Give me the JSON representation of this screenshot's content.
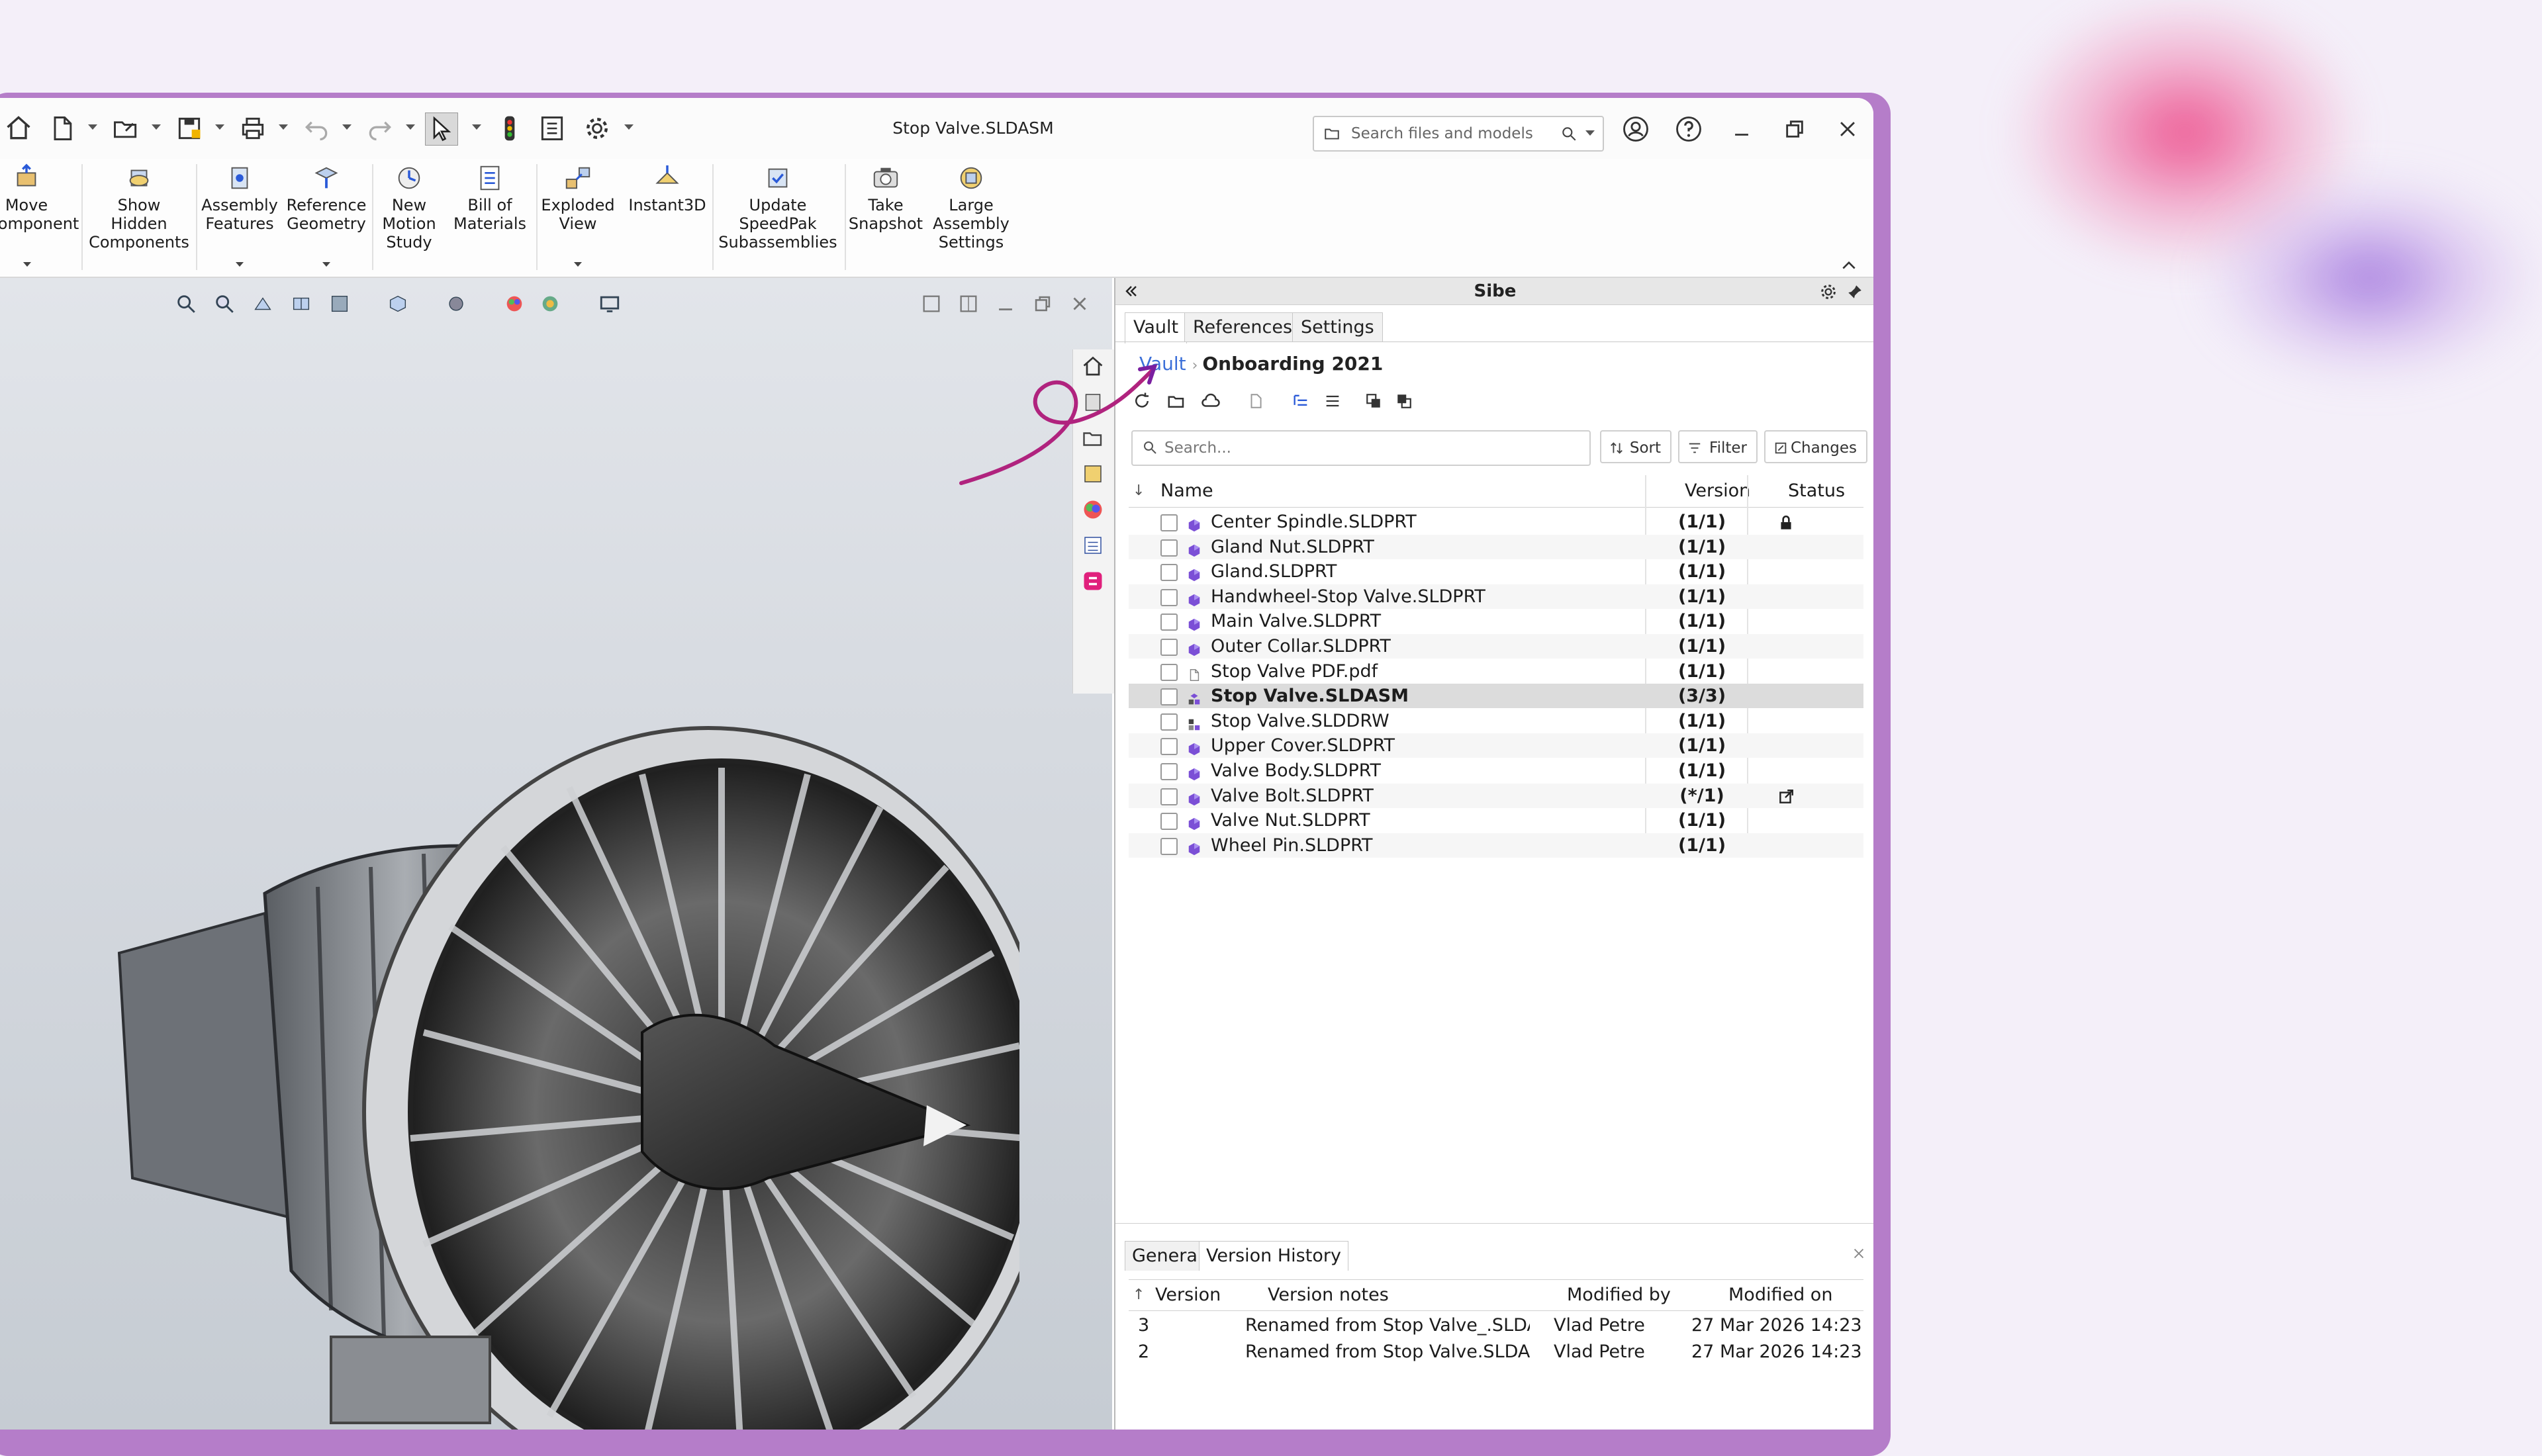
{
  "window": {
    "title": "Stop Valve.SLDASM"
  },
  "search": {
    "placeholder": "Search files and models"
  },
  "ribbon": [
    {
      "label": "Move\nComponent",
      "icon": "move-component-icon"
    },
    {
      "label": "Show\nHidden\nComponents",
      "icon": "show-hidden-icon"
    },
    {
      "label": "Assembly\nFeatures",
      "icon": "assembly-features-icon"
    },
    {
      "label": "Reference\nGeometry",
      "icon": "reference-geometry-icon"
    },
    {
      "label": "New\nMotion\nStudy",
      "icon": "motion-study-icon"
    },
    {
      "label": "Bill of\nMaterials",
      "icon": "bom-icon"
    },
    {
      "label": "Exploded\nView",
      "icon": "exploded-view-icon"
    },
    {
      "label": "Instant3D",
      "icon": "instant3d-icon"
    },
    {
      "label": "Update\nSpeedPak\nSubassemblies",
      "icon": "speedpak-icon"
    },
    {
      "label": "Take\nSnapshot",
      "icon": "camera-icon"
    },
    {
      "label": "Large\nAssembly\nSettings",
      "icon": "large-assembly-icon"
    }
  ],
  "panel": {
    "title": "Sibe",
    "tabs": [
      "Vault",
      "References",
      "Settings"
    ],
    "active_tab": "Vault",
    "breadcrumb": {
      "root": "Vault",
      "current": "Onboarding 2021"
    },
    "search_placeholder": "Search...",
    "buttons": {
      "sort": "Sort",
      "filter": "Filter",
      "changes": "Changes"
    },
    "columns": {
      "name": "Name",
      "version": "Version",
      "status": "Status"
    },
    "files": [
      {
        "name": "Center Spindle.SLDPRT",
        "version": "(1/1)",
        "type": "part",
        "status": "locked"
      },
      {
        "name": "Gland Nut.SLDPRT",
        "version": "(1/1)",
        "type": "part",
        "status": ""
      },
      {
        "name": "Gland.SLDPRT",
        "version": "(1/1)",
        "type": "part",
        "status": ""
      },
      {
        "name": "Handwheel-Stop Valve.SLDPRT",
        "version": "(1/1)",
        "type": "part",
        "status": ""
      },
      {
        "name": "Main Valve.SLDPRT",
        "version": "(1/1)",
        "type": "part",
        "status": ""
      },
      {
        "name": "Outer Collar.SLDPRT",
        "version": "(1/1)",
        "type": "part",
        "status": ""
      },
      {
        "name": "Stop Valve PDF.pdf",
        "version": "(1/1)",
        "type": "pdf",
        "status": ""
      },
      {
        "name": "Stop Valve.SLDASM",
        "version": "(3/3)",
        "type": "assembly",
        "status": "",
        "selected": true
      },
      {
        "name": "Stop Valve.SLDDRW",
        "version": "(1/1)",
        "type": "drawing",
        "status": ""
      },
      {
        "name": "Upper Cover.SLDPRT",
        "version": "(1/1)",
        "type": "part",
        "status": ""
      },
      {
        "name": "Valve Body.SLDPRT",
        "version": "(1/1)",
        "type": "part",
        "status": ""
      },
      {
        "name": "Valve Bolt.SLDPRT",
        "version": "(*/1)",
        "type": "part",
        "status": "checked-out"
      },
      {
        "name": "Valve Nut.SLDPRT",
        "version": "(1/1)",
        "type": "part",
        "status": ""
      },
      {
        "name": "Wheel Pin.SLDPRT",
        "version": "(1/1)",
        "type": "part",
        "status": ""
      }
    ],
    "bottom": {
      "tabs": [
        "General",
        "Version History"
      ],
      "active_tab": "Version History",
      "columns": {
        "version": "Version",
        "notes": "Version notes",
        "by": "Modified by",
        "on": "Modified on"
      },
      "history": [
        {
          "version": "3",
          "notes": "Renamed from Stop Valve_.SLDASM",
          "by": "Vlad Petre",
          "on": "27 Mar 2026 14:23"
        },
        {
          "version": "2",
          "notes": "Renamed from Stop Valve.SLDASM",
          "by": "Vlad Petre",
          "on": "27 Mar 2026 14:23"
        }
      ]
    }
  },
  "colors": {
    "accent": "#3b6fd8",
    "frame": "#b57dc9",
    "part_icon": "#7b4fd6",
    "scribble": "#b0237e"
  }
}
